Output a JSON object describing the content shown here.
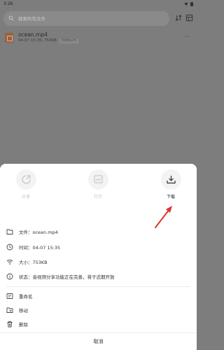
{
  "status_bar": {
    "time": "3:26"
  },
  "search": {
    "placeholder": "搜索所有文件"
  },
  "file": {
    "name": "ocean.mp4",
    "meta": "04-07 15:35, 753KB",
    "tag": "音视频分享"
  },
  "sheet": {
    "actions": [
      {
        "label": "分享",
        "icon": "share-icon",
        "enabled": false
      },
      {
        "label": "打开",
        "icon": "open-icon",
        "enabled": false
      },
      {
        "label": "下载",
        "icon": "download-icon",
        "enabled": true
      }
    ],
    "info": {
      "filename_label": "文件：",
      "filename_value": "ocean.mp4",
      "time_label": "时间：",
      "time_value": "04-07 15:35",
      "size_label": "大小：",
      "size_value": "753KB",
      "status_label": "状态：",
      "status_value": "音视频分享功能正在完善，将于近期开放"
    },
    "menu": [
      {
        "label": "重命名",
        "icon": "rename-icon"
      },
      {
        "label": "移动",
        "icon": "move-icon"
      },
      {
        "label": "删除",
        "icon": "delete-icon"
      }
    ],
    "cancel": "取消"
  },
  "annotation": {
    "arrow_color": "#e0332d"
  }
}
